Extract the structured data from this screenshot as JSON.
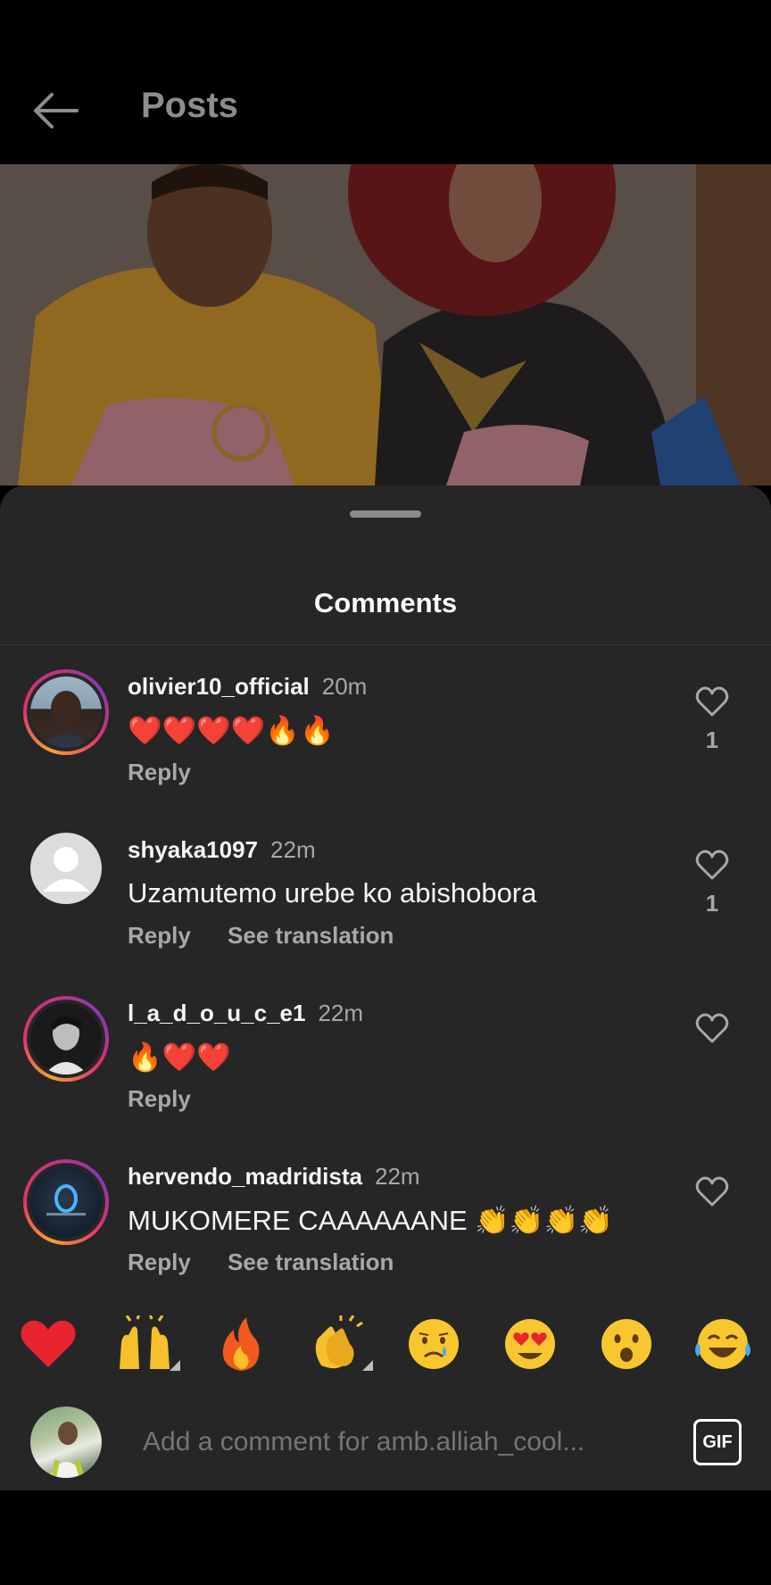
{
  "header": {
    "title": "Posts",
    "back_icon": "arrow-left-icon"
  },
  "sheet": {
    "title": "Comments"
  },
  "comments": [
    {
      "username": "olivier10_official",
      "time": "20m",
      "text": "❤️❤️❤️❤️🔥🔥",
      "reply": "Reply",
      "translate": "",
      "likes": "1"
    },
    {
      "username": "shyaka1097",
      "time": "22m",
      "text": "Uzamutemo urebe ko abishobora",
      "reply": "Reply",
      "translate": "See translation",
      "likes": "1"
    },
    {
      "username": "l_a_d_o_u_c_e1",
      "time": "22m",
      "text": "🔥❤️❤️",
      "reply": "Reply",
      "translate": "",
      "likes": ""
    },
    {
      "username": "hervendo_madridista",
      "time": "22m",
      "text": "MUKOMERE CAAAAAANE 👏👏👏👏",
      "reply": "Reply",
      "translate": "See translation",
      "likes": ""
    }
  ],
  "quick_reactions": [
    "red-heart",
    "raising-hands",
    "fire",
    "clapping-hands",
    "crying-face",
    "heart-eyes-face",
    "surprised-face",
    "tears-of-joy-face"
  ],
  "composer": {
    "placeholder": "Add a comment for amb.alliah_cool...",
    "gif_label": "GIF"
  },
  "colors": {
    "sheet_bg": "#262626",
    "secondary_text": "#a8a8a8",
    "story_ring": "#e1306c"
  }
}
